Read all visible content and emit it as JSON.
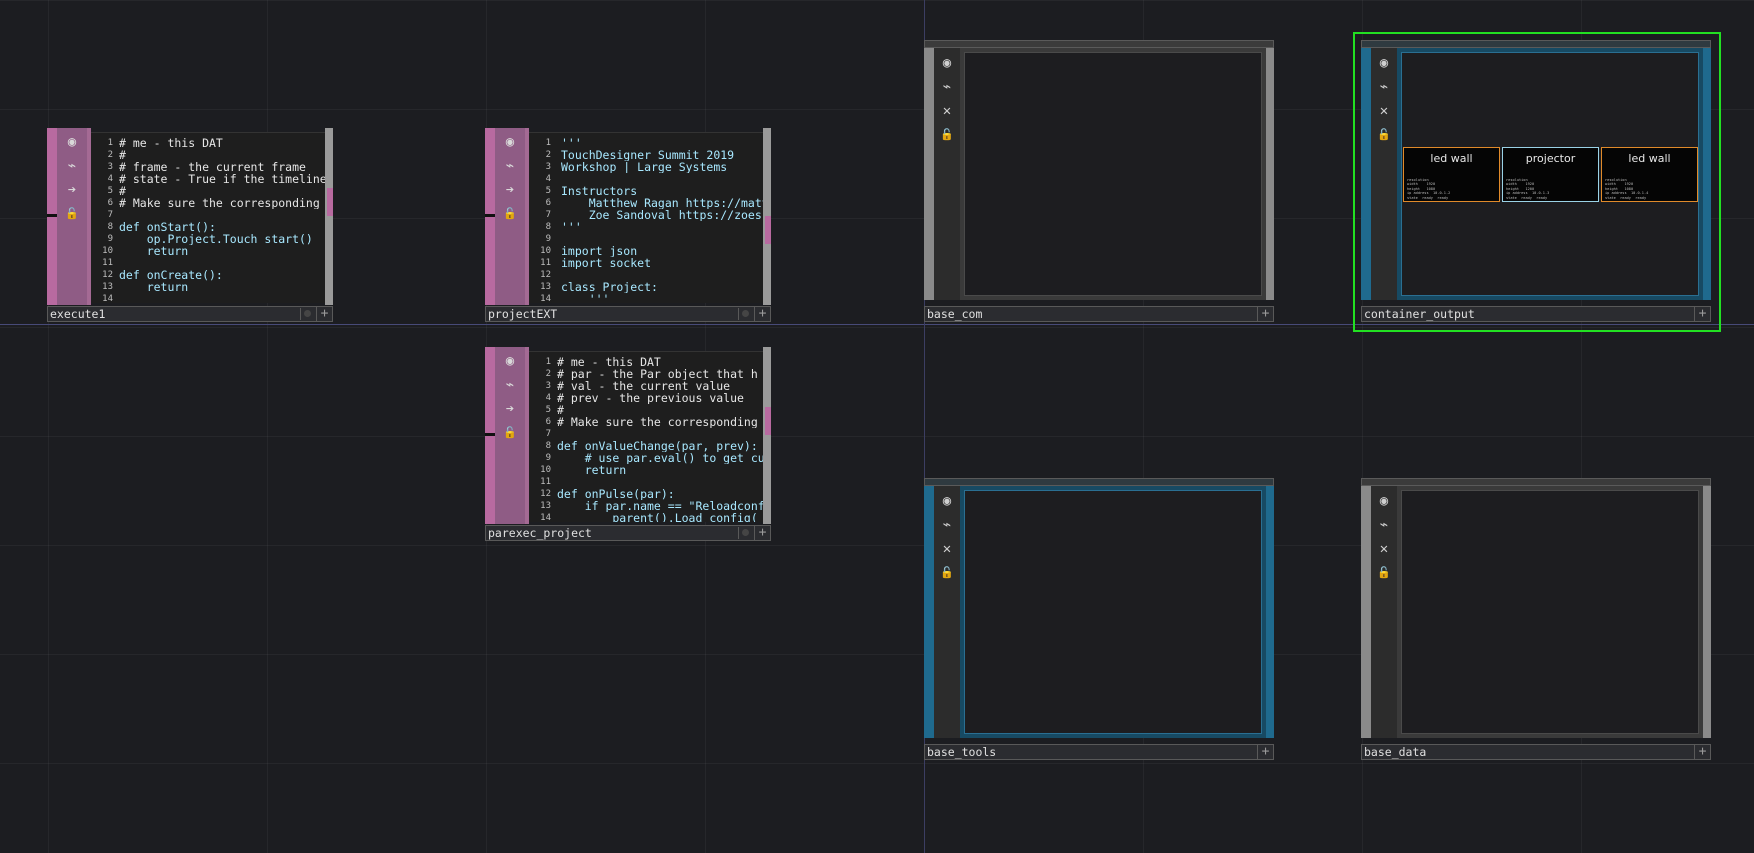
{
  "nodes": {
    "execute1": {
      "name": "execute1",
      "line_numbers": [
        "1",
        "2",
        "3",
        "4",
        "5",
        "6",
        "7",
        "8",
        "9",
        "10",
        "11",
        "12",
        "13",
        "14"
      ],
      "lines": [
        "# me - this DAT",
        "#",
        "# frame - the current frame",
        "# state - True if the timeline",
        "#",
        "# Make sure the corresponding",
        "",
        "def onStart():",
        "    op.Project.Touch_start()",
        "    return",
        "",
        "def onCreate():",
        "    return",
        ""
      ]
    },
    "projectEXT": {
      "name": "projectEXT",
      "line_numbers": [
        "1",
        "2",
        "3",
        "4",
        "5",
        "6",
        "7",
        "8",
        "9",
        "10",
        "11",
        "12",
        "13",
        "14"
      ],
      "lines": [
        "'''",
        "TouchDesigner Summit 2019",
        "Workshop | Large Systems",
        "",
        "Instructors",
        "    Matthew Ragan https://matt",
        "    Zoe Sandoval https://zoes",
        "'''",
        "",
        "import json",
        "import socket",
        "",
        "class Project:",
        "    '''"
      ]
    },
    "parexec_project": {
      "name": "parexec_project",
      "line_numbers": [
        "1",
        "2",
        "3",
        "4",
        "5",
        "6",
        "7",
        "8",
        "9",
        "10",
        "11",
        "12",
        "13",
        "14"
      ],
      "lines": [
        "# me - this DAT",
        "# par - the Par object that h",
        "# val - the current value",
        "# prev - the previous value",
        "#",
        "# Make sure the corresponding",
        "",
        "def onValueChange(par, prev):",
        "    # use par.eval() to get cu",
        "    return",
        "",
        "def onPulse(par):",
        "    if par.name == \"Reloadconf",
        "        parent().Load_config("
      ]
    },
    "base_com": {
      "name": "base_com"
    },
    "container_output": {
      "name": "container_output",
      "tiles": [
        {
          "title": "led wall",
          "info": "resolution\nwidth    1920\nheight   1080\nip address  10.0.1.2\nstate  ready  ready"
        },
        {
          "title": "projector",
          "info": "resolution\nwidth    1920\nheight   1200\nip address  10.0.1.3\nstate  ready  ready"
        },
        {
          "title": "led wall",
          "info": "resolution\nwidth    1920\nheight   1080\nip address  10.0.1.4\nstate  ready  ready"
        }
      ]
    },
    "base_tools": {
      "name": "base_tools"
    },
    "base_data": {
      "name": "base_data"
    }
  },
  "icons": {
    "viewer": "◉",
    "bypass": "⌁",
    "arrow": "➔",
    "cross": "✕",
    "lock": "🔓",
    "plus": "+"
  },
  "colors": {
    "dat": "#b86aa0",
    "base": "#8a8a8a",
    "container": "#1f6a8e",
    "selection": "#22e022"
  }
}
